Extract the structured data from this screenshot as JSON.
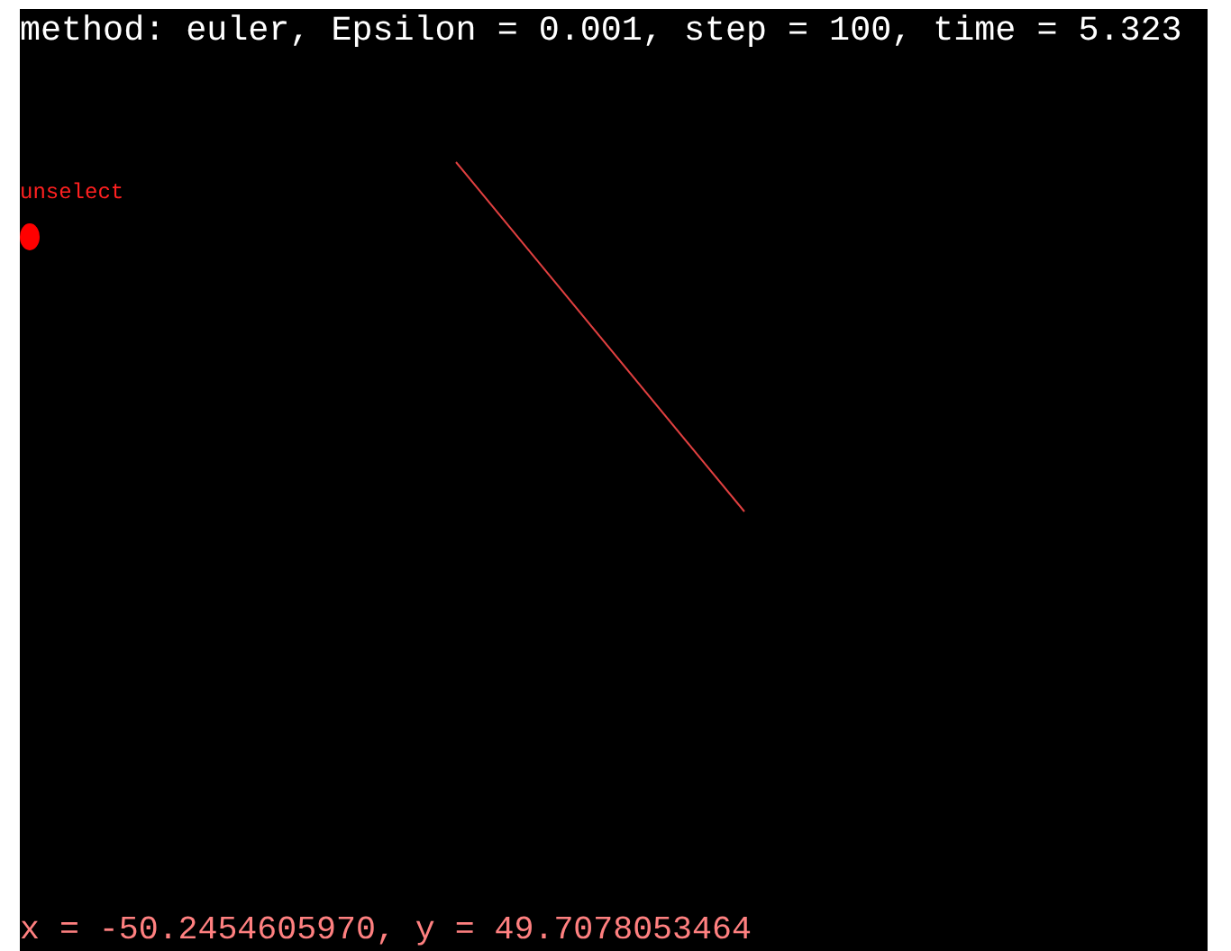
{
  "status": "method: euler, Epsilon = 0.001, step = 100, time = 5.323",
  "selection_label": "unselect",
  "coordinates": "x = -50.2454605970, y = 49.7078053464"
}
